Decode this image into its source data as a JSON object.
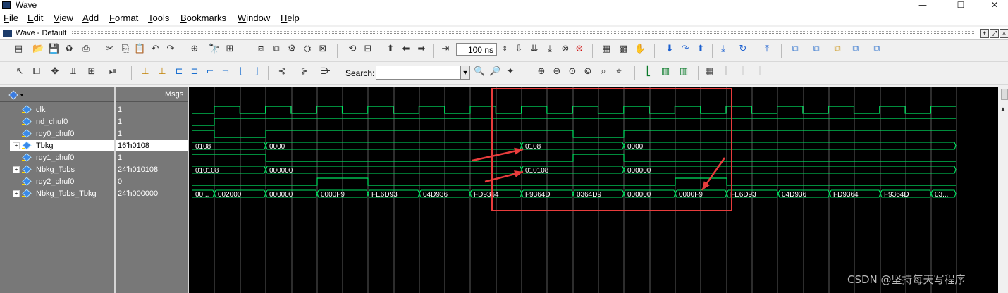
{
  "window": {
    "title": "Wave",
    "minimize": "—",
    "maximize": "☐",
    "close": "✕"
  },
  "menu": [
    "File",
    "Edit",
    "View",
    "Add",
    "Format",
    "Tools",
    "Bookmarks",
    "Window",
    "Help"
  ],
  "subwindow": {
    "title": "Wave - Default"
  },
  "toolbar": {
    "time_value": "100",
    "time_unit": "ns",
    "search_label": "Search:",
    "search_value": ""
  },
  "panes": {
    "msgs_header": "Msgs"
  },
  "signals": [
    {
      "name": "clk",
      "value": "1",
      "expandable": false,
      "selected": false
    },
    {
      "name": "nd_chuf0",
      "value": "1",
      "expandable": false,
      "selected": false
    },
    {
      "name": "rdy0_chuf0",
      "value": "1",
      "expandable": false,
      "selected": false
    },
    {
      "name": "Tbkg",
      "value": "16'h0108",
      "expandable": true,
      "selected": true
    },
    {
      "name": "rdy1_chuf0",
      "value": "1",
      "expandable": false,
      "selected": false
    },
    {
      "name": "Nbkg_Tobs",
      "value": "24'h010108",
      "expandable": true,
      "selected": false
    },
    {
      "name": "rdy2_chuf0",
      "value": "0",
      "expandable": false,
      "selected": false
    },
    {
      "name": "Nbkg_Tobs_Tbkg",
      "value": "24'h000000",
      "expandable": true,
      "selected": false
    }
  ],
  "wave_labels": {
    "Tbkg": [
      "0108",
      "0000",
      "0108",
      "0000"
    ],
    "Nbkg_Tobs": [
      "010108",
      "000000",
      "010108",
      "000000"
    ],
    "Nbkg_Tobs_Tbkg": [
      "00...",
      "002000",
      "000000",
      "0000F9",
      "FE6D93",
      "04D936",
      "FD9364",
      "F9364D",
      "0364D9",
      "000000",
      "0000F9",
      "FE6D93",
      "04D936",
      "FD9364",
      "F9364D",
      "03..."
    ]
  },
  "colors": {
    "wave": "#00e060",
    "bus_text": "#ffffff",
    "annotation": "#e83c3c",
    "background": "#000000",
    "grid": "#5a5a5a"
  },
  "watermark": "CSDN @坚持每天写程序"
}
